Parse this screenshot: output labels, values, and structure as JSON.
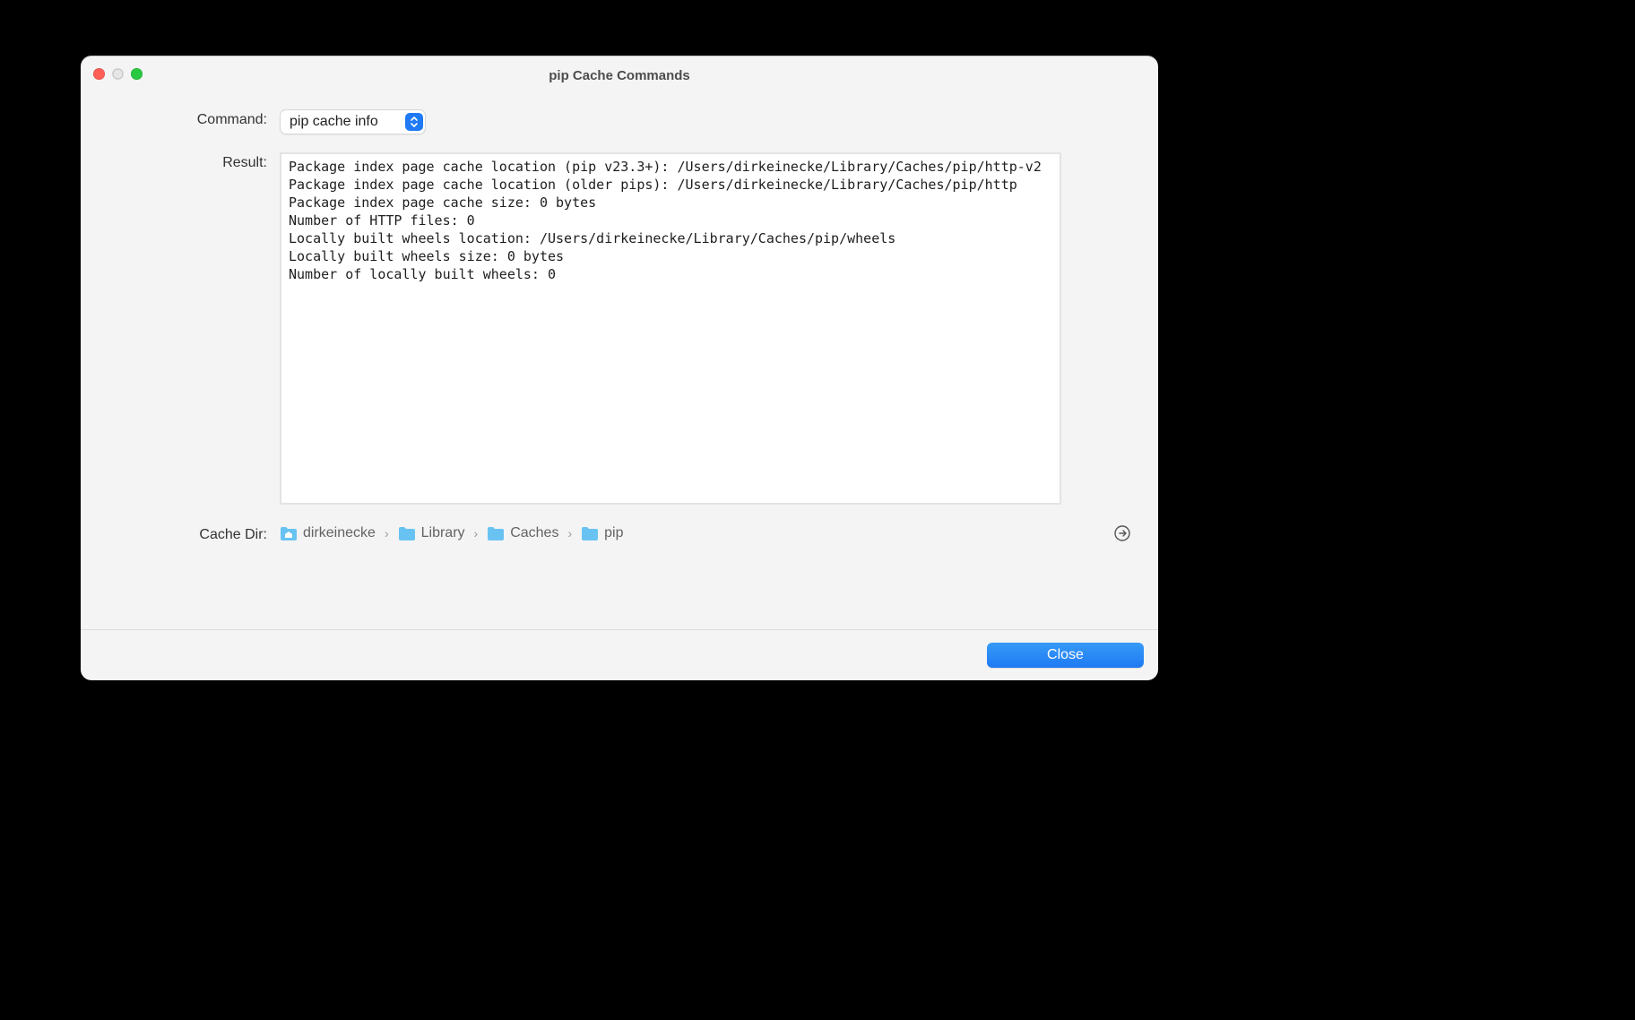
{
  "window": {
    "title": "pip Cache Commands"
  },
  "form": {
    "command_label": "Command:",
    "command_value": "pip cache info",
    "result_label": "Result:",
    "result_value": "Package index page cache location (pip v23.3+): /Users/dirkeinecke/Library/Caches/pip/http-v2\nPackage index page cache location (older pips): /Users/dirkeinecke/Library/Caches/pip/http\nPackage index page cache size: 0 bytes\nNumber of HTTP files: 0\nLocally built wheels location: /Users/dirkeinecke/Library/Caches/pip/wheels\nLocally built wheels size: 0 bytes\nNumber of locally built wheels: 0",
    "cachedir_label": "Cache Dir:"
  },
  "breadcrumb": {
    "items": [
      {
        "icon": "home-folder-icon",
        "label": "dirkeinecke"
      },
      {
        "icon": "folder-icon",
        "label": "Library"
      },
      {
        "icon": "folder-icon",
        "label": "Caches"
      },
      {
        "icon": "folder-icon",
        "label": "pip"
      }
    ]
  },
  "footer": {
    "close_label": "Close"
  }
}
